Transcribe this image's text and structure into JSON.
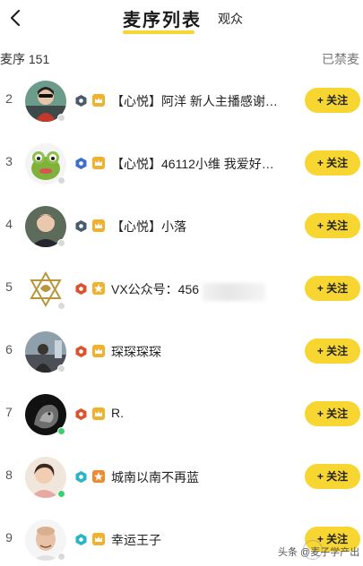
{
  "header": {
    "back_icon": "chevron-left-icon",
    "active_tab": "麦序列表",
    "inactive_tab": "观众",
    "accent_color": "#f7d631"
  },
  "subheader": {
    "queue_count": "麦序 151",
    "banned_link": "已禁麦"
  },
  "rows": [
    {
      "index": "2",
      "name": "【心悦】阿洋 新人主播感谢…",
      "level": "dark",
      "medal": "crown",
      "online": false,
      "follow": "+ 关注"
    },
    {
      "index": "3",
      "name": "【心悦】46112小维 我爱好…",
      "level": "blue",
      "medal": "crown",
      "online": false,
      "follow": "+ 关注"
    },
    {
      "index": "4",
      "name": "【心悦】小落",
      "level": "dark",
      "medal": "crown",
      "online": false,
      "follow": "+ 关注"
    },
    {
      "index": "5",
      "name": "VX公众号：456",
      "level": "red",
      "medal": "star",
      "online": false,
      "follow": "+ 关注"
    },
    {
      "index": "6",
      "name": "琛琛琛琛",
      "level": "red",
      "medal": "crown",
      "online": false,
      "follow": "+ 关注"
    },
    {
      "index": "7",
      "name": "R.",
      "level": "red",
      "medal": "crown",
      "online": true,
      "follow": "+ 关注"
    },
    {
      "index": "8",
      "name": "城南以南不再蓝",
      "level": "teal",
      "medal": "star",
      "online": true,
      "follow": "+ 关注"
    },
    {
      "index": "9",
      "name": "幸运王子",
      "level": "teal",
      "medal": "crown",
      "online": false,
      "follow": "+ 关注"
    }
  ],
  "watermark": "头条 @麦子学产出"
}
